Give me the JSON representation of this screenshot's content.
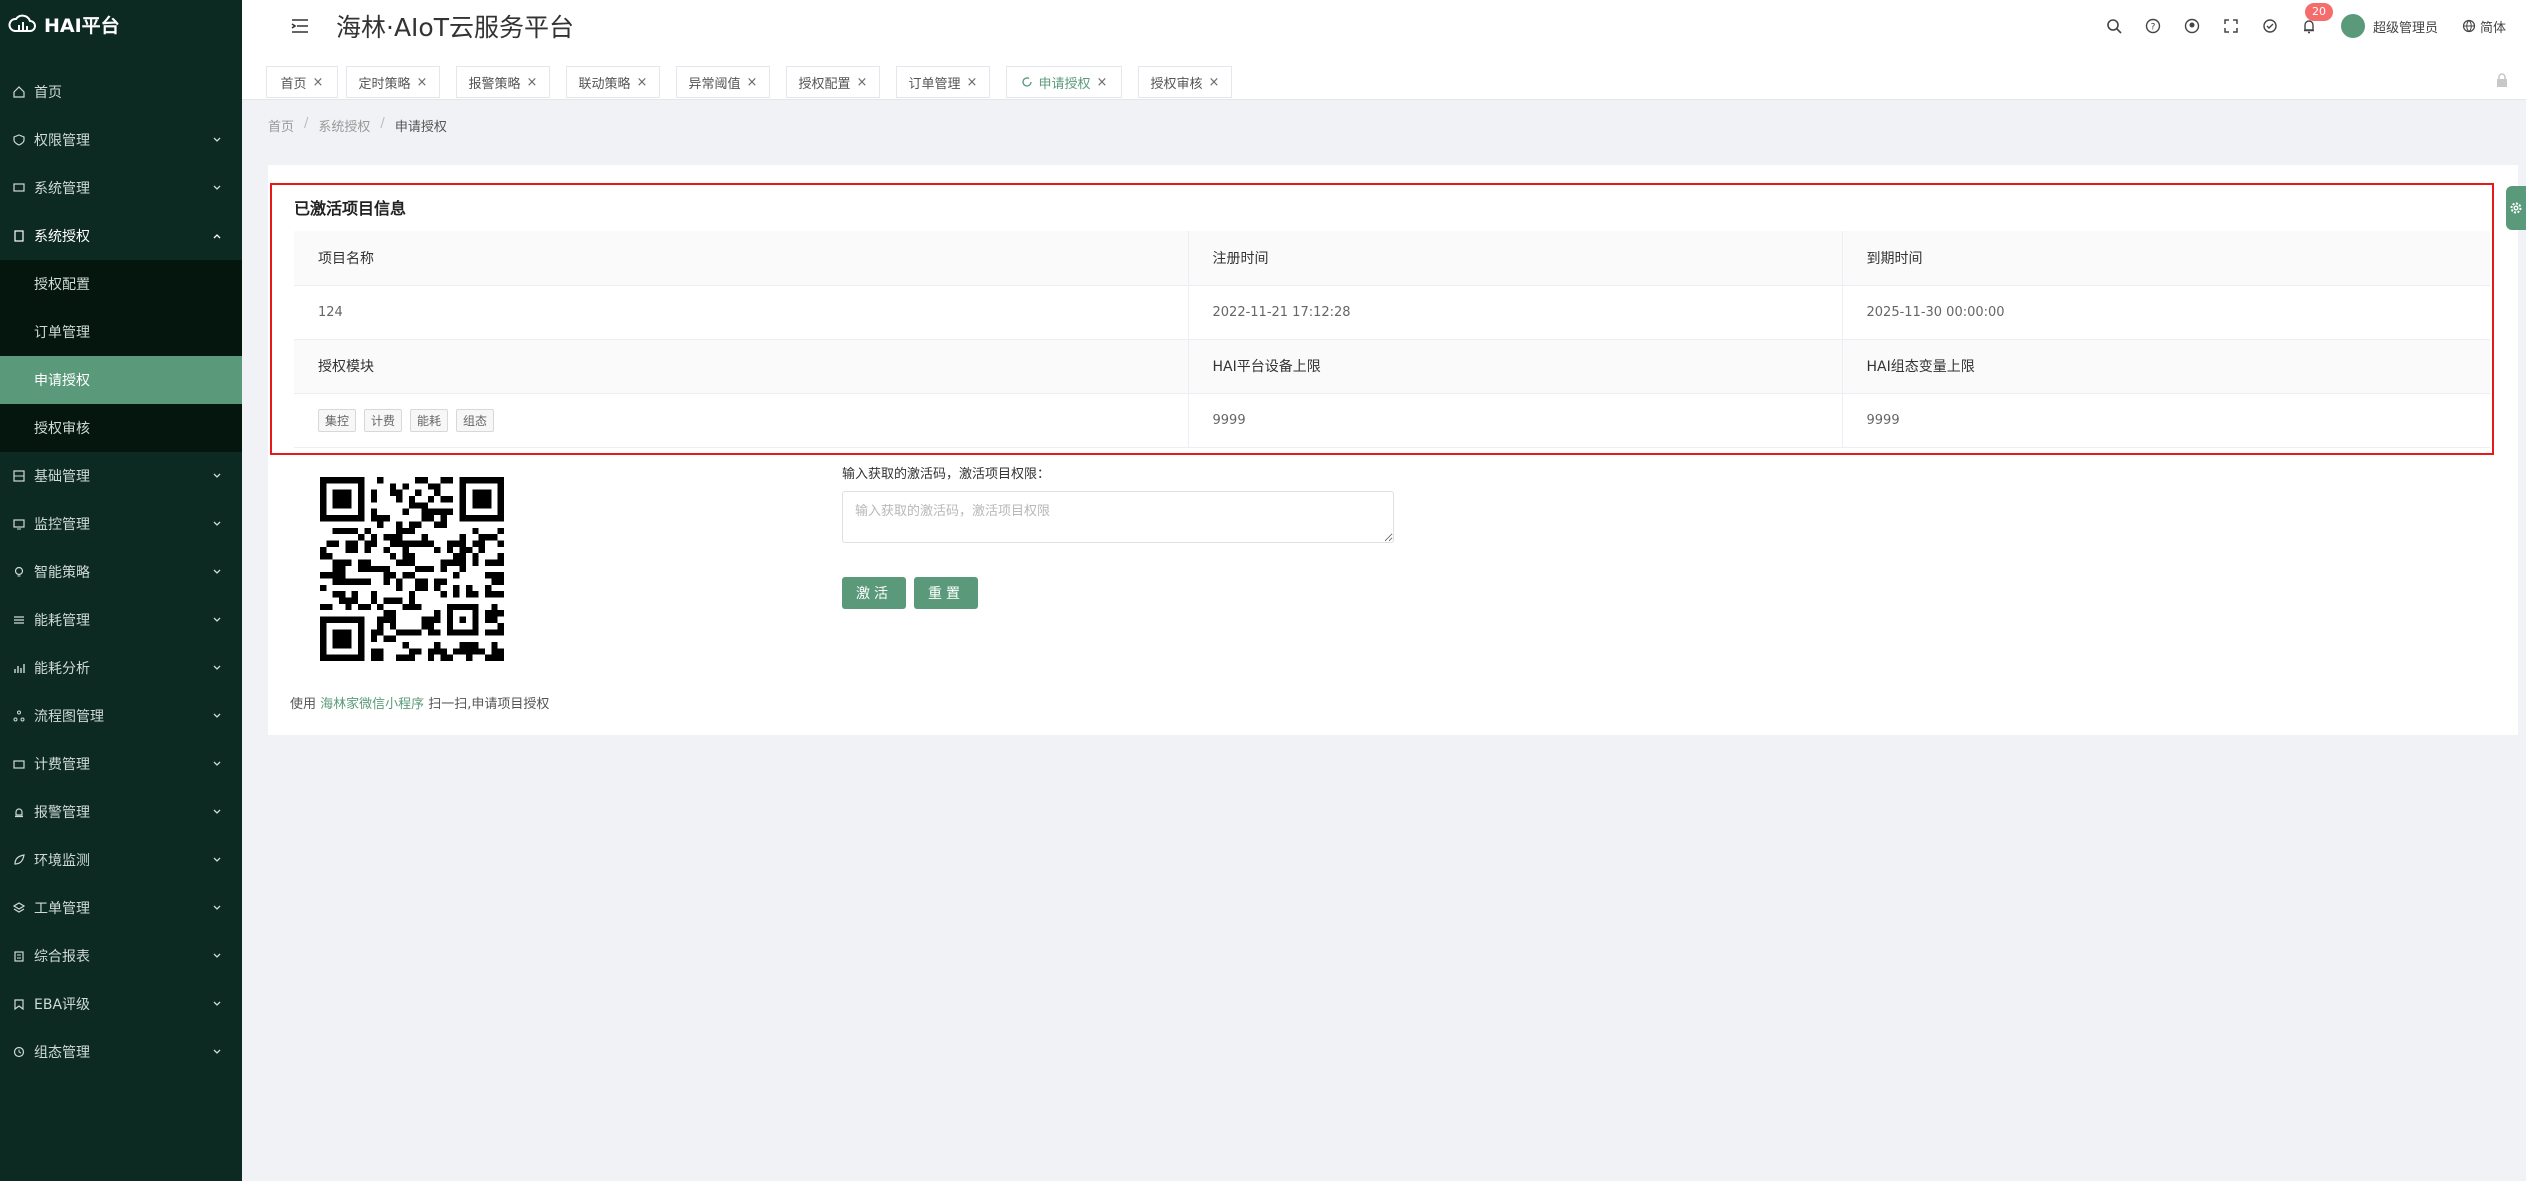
{
  "brand": {
    "name": "HAI平台"
  },
  "header": {
    "title": "海林·AIoT云服务平台",
    "notification_count": "20",
    "user_name": "超级管理员",
    "language": "简体"
  },
  "sidebar": {
    "items": [
      {
        "label": "首页",
        "icon": "home-icon"
      },
      {
        "label": "权限管理",
        "icon": "shield-icon"
      },
      {
        "label": "系统管理",
        "icon": "monitor-icon"
      },
      {
        "label": "系统授权",
        "icon": "document-icon"
      },
      {
        "label": "基础管理",
        "icon": "grid-icon"
      },
      {
        "label": "监控管理",
        "icon": "monitor-icon"
      },
      {
        "label": "智能策略",
        "icon": "bulb-icon"
      },
      {
        "label": "能耗管理",
        "icon": "sliders-icon"
      },
      {
        "label": "能耗分析",
        "icon": "bar-chart-icon"
      },
      {
        "label": "流程图管理",
        "icon": "flow-icon"
      },
      {
        "label": "计费管理",
        "icon": "wallet-icon"
      },
      {
        "label": "报警管理",
        "icon": "alarm-icon"
      },
      {
        "label": "环境监测",
        "icon": "leaf-icon"
      },
      {
        "label": "工单管理",
        "icon": "layers-icon"
      },
      {
        "label": "综合报表",
        "icon": "report-icon"
      },
      {
        "label": "EBA评级",
        "icon": "badge-icon"
      },
      {
        "label": "组态管理",
        "icon": "clock-icon"
      }
    ],
    "sub_items": [
      "授权配置",
      "订单管理",
      "申请授权",
      "授权审核"
    ]
  },
  "tabs": [
    "首页",
    "定时策略",
    "报警策略",
    "联动策略",
    "异常阈值",
    "授权配置",
    "订单管理",
    "申请授权",
    "授权审核"
  ],
  "breadcrumb": [
    "首页",
    "系统授权",
    "申请授权"
  ],
  "section": {
    "title": "已激活项目信息",
    "headers1": [
      "项目名称",
      "注册时间",
      "到期时间"
    ],
    "values1": [
      "124",
      "2022-11-21 17:12:28",
      "2025-11-30 00:00:00"
    ],
    "headers2": [
      "授权模块",
      "HAI平台设备上限",
      "HAI组态变量上限"
    ],
    "modules": [
      "集控",
      "计费",
      "能耗",
      "组态"
    ],
    "values2": [
      "9999",
      "9999"
    ]
  },
  "qr": {
    "caption_prefix": "使用 ",
    "caption_link": "海林家微信小程序",
    "caption_suffix": " 扫一扫,申请项目授权"
  },
  "form": {
    "label": "输入获取的激活码，激活项目权限：",
    "placeholder": "输入获取的激活码，激活项目权限",
    "activate": "激活",
    "reset": "重置"
  },
  "colors": {
    "sidebar": "#0d2a22",
    "accent": "#5a9a7a",
    "highlight": "#e8181b"
  }
}
